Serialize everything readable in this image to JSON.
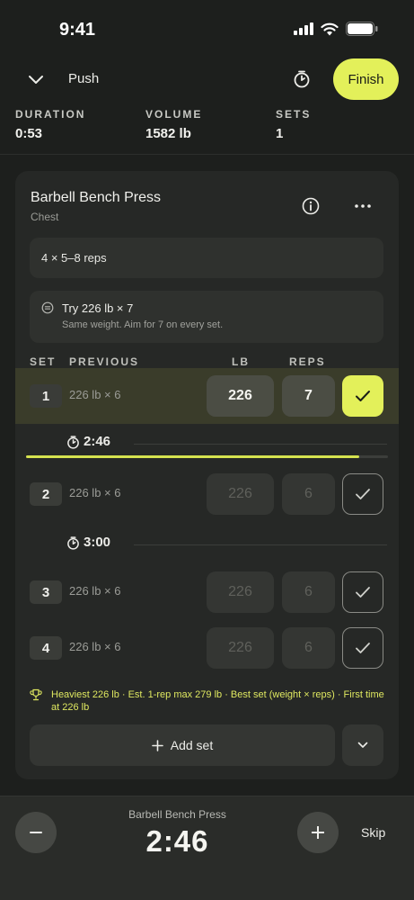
{
  "status_bar": {
    "time": "9:41"
  },
  "header": {
    "workout_name": "Push",
    "finish_label": "Finish"
  },
  "stats": [
    {
      "label": "DURATION",
      "value": "0:53"
    },
    {
      "label": "VOLUME",
      "value": "1582 lb"
    },
    {
      "label": "SETS",
      "value": "1"
    }
  ],
  "exercise": {
    "name": "Barbell Bench Press",
    "muscle": "Chest",
    "target": "4 × 5–8 reps",
    "tip_title": "Try 226 lb × 7",
    "tip_sub": "Same weight. Aim for 7 on every set.",
    "columns": {
      "set": "SET",
      "previous": "PREVIOUS",
      "weight": "LB",
      "reps": "REPS"
    },
    "sets": [
      {
        "number": "1",
        "previous": "226 lb × 6",
        "weight": "226",
        "reps": "7",
        "completed": true
      },
      {
        "number": "2",
        "previous": "226 lb × 6",
        "weight": "226",
        "reps": "6",
        "completed": false
      },
      {
        "number": "3",
        "previous": "226 lb × 6",
        "weight": "226",
        "reps": "6",
        "completed": false
      },
      {
        "number": "4",
        "previous": "226 lb × 6",
        "weight": "226",
        "reps": "6",
        "completed": false
      }
    ],
    "rest_timers": [
      {
        "time": "2:46",
        "progress": 0.92
      },
      {
        "time": "3:00"
      }
    ],
    "pr_text": "Heaviest 226 lb · Est. 1-rep max 279 lb · Best set (weight × reps) · First time at 226 lb",
    "add_set_label": "Add set"
  },
  "rest_bar": {
    "exercise": "Barbell Bench Press",
    "time": "2:46",
    "skip_label": "Skip"
  },
  "colors": {
    "accent": "#e3f05a",
    "background": "#1d1f1d",
    "card": "#262826",
    "active_row": "#3a3c2a"
  },
  "icons": [
    "chevron-down-icon",
    "stopwatch-icon",
    "info-icon",
    "more-icon",
    "tip-icon",
    "check-icon",
    "trophy-icon",
    "plus-icon",
    "minus-icon",
    "signal-icon",
    "wifi-icon",
    "battery-icon"
  ]
}
